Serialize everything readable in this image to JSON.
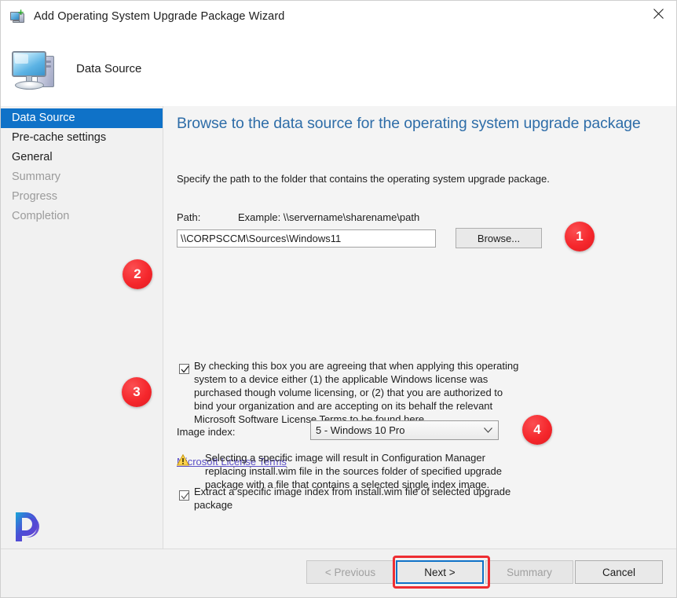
{
  "window": {
    "title": "Add Operating System Upgrade Package Wizard",
    "title_icon": "computer-upgrade-icon",
    "close_icon": "close-icon",
    "header_title": "Data Source",
    "header_icon": "computer-icon",
    "logo": "p-logo-watermark"
  },
  "sidebar": {
    "items": [
      {
        "label": "Data Source",
        "state": "selected"
      },
      {
        "label": "Pre-cache settings",
        "state": "enabled"
      },
      {
        "label": "General",
        "state": "enabled"
      },
      {
        "label": "Summary",
        "state": "disabled"
      },
      {
        "label": "Progress",
        "state": "disabled"
      },
      {
        "label": "Completion",
        "state": "disabled"
      }
    ]
  },
  "content": {
    "heading": "Browse to the data source for the operating system upgrade package",
    "subtitle": "Specify the path to the folder that contains the operating system upgrade package.",
    "path_label": "Path:",
    "path_example": "Example: \\\\servername\\sharename\\path",
    "path_value": "\\\\CORPSCCM\\Sources\\Windows11",
    "path_placeholder": "",
    "browse_label": "Browse...",
    "license_checkbox": {
      "checked": true,
      "label": "By checking this box you are agreeing that when applying this operating system to a device either (1) the applicable Windows license was purchased though volume licensing, or (2) that you are authorized to bind your organization and are accepting on its behalf the relevant Microsoft Software License Terms to be found here."
    },
    "license_link": "Microsoft License Terms",
    "extract_checkbox": {
      "checked": true,
      "label": "Extract a specific image index from install.wim file of selected upgrade package"
    },
    "index_label": "Image index:",
    "index_value": "5 - Windows 10 Pro",
    "index_arrow_icon": "chevron-down-icon",
    "warning_icon": "warning-triangle-icon",
    "warning_text": "Selecting a specific image will result in Configuration Manager replacing install.wim file in the sources folder of specified upgrade package with a file that contains a selected single index image."
  },
  "footer": {
    "previous_label": "< Previous",
    "next_label": "Next >",
    "summary_label": "Summary",
    "cancel_label": "Cancel"
  },
  "annotations": {
    "badge_1": "1",
    "badge_2": "2",
    "badge_3": "3",
    "badge_4": "4",
    "highlight_color": "#ee2d32"
  }
}
